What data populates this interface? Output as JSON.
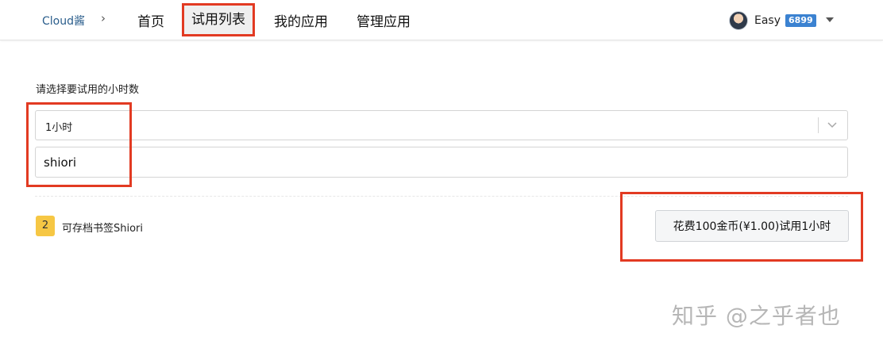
{
  "nav": {
    "brand": "Cloud酱",
    "separator": "›",
    "items": [
      {
        "label": "首页",
        "active": false
      },
      {
        "label": "试用列表",
        "active": true
      },
      {
        "label": "我的应用",
        "active": false
      },
      {
        "label": "管理应用",
        "active": false
      }
    ],
    "user": {
      "name": "Easy",
      "coins": "6899"
    }
  },
  "form": {
    "label": "请选择要试用的小时数",
    "select_value": "1小时",
    "input_value": "shiori"
  },
  "item": {
    "badge": "2",
    "title": "可存档书签Shiori",
    "button_label": "花费100金币(¥1.00)试用1小时"
  },
  "watermark": "知乎 @之乎者也",
  "colors": {
    "annotation_red": "#e23a22",
    "coin_badge": "#3b82d1",
    "item_badge": "#f6c744",
    "brand_link": "#2b5e8c"
  },
  "icons": {
    "breadcrumb": "chevron-right-icon",
    "user_menu": "caret-down-icon",
    "select": "chevron-down-icon"
  }
}
